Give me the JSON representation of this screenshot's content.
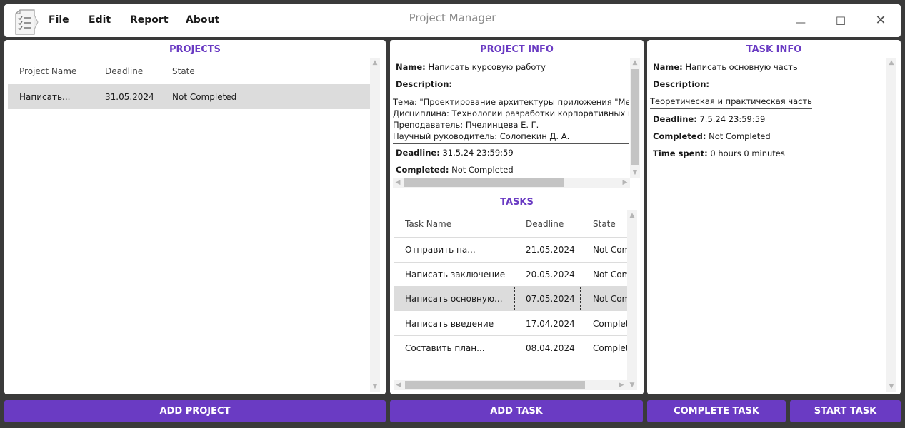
{
  "window": {
    "title": "Project Manager",
    "menu": [
      "File",
      "Edit",
      "Report",
      "About"
    ],
    "controls": {
      "minimize": "—",
      "maximize": "☐",
      "close": "✕"
    }
  },
  "projects": {
    "title": "PROJECTS",
    "columns": [
      "Project Name",
      "Deadline",
      "State"
    ],
    "rows": [
      {
        "name": "Написать...",
        "deadline": "31.05.2024",
        "state": "Not Completed",
        "selected": true
      }
    ]
  },
  "project_info": {
    "title": "PROJECT INFO",
    "name_label": "Name:",
    "name_value": "Написать курсовую работу",
    "description_label": "Description:",
    "description_lines": [
      "Тема: \"Проектирование архитектуры приложения \"Менедж",
      "Дисциплина: Технологии разработки корпоративных инфор",
      "Преподаватель: Пчелинцева Е. Г.",
      "Научный руководитель: Солопекин Д. А."
    ],
    "deadline_label": "Deadline:",
    "deadline_value": "31.5.24 23:59:59",
    "completed_label": "Completed:",
    "completed_value": "Not Completed"
  },
  "tasks": {
    "title": "TASKS",
    "columns": [
      "Task Name",
      "Deadline",
      "State"
    ],
    "rows": [
      {
        "name": "Отправить на...",
        "deadline": "21.05.2024",
        "state": "Not Com"
      },
      {
        "name": "Написать заключение",
        "deadline": "20.05.2024",
        "state": "Not Com"
      },
      {
        "name": "Написать основную...",
        "deadline": "07.05.2024",
        "state": "Not Com",
        "selected": true
      },
      {
        "name": "Написать введение",
        "deadline": "17.04.2024",
        "state": "Complet"
      },
      {
        "name": "Составить план...",
        "deadline": "08.04.2024",
        "state": "Complet"
      }
    ]
  },
  "task_info": {
    "title": "TASK INFO",
    "name_label": "Name:",
    "name_value": "Написать основную часть",
    "description_label": "Description:",
    "description_value": "Теоретическая и практическая часть",
    "deadline_label": "Deadline:",
    "deadline_value": "7.5.24 23:59:59",
    "completed_label": "Completed:",
    "completed_value": "Not Completed",
    "time_spent_label": "Time spent:",
    "time_spent_value": "0 hours 0 minutes"
  },
  "buttons": {
    "add_project": "ADD PROJECT",
    "add_task": "ADD TASK",
    "complete_task": "COMPLETE TASK",
    "start_task": "START TASK"
  },
  "colors": {
    "accent": "#6a3bc3",
    "selected_row": "#dcdcdc",
    "background": "#3a3a3a"
  },
  "icons": [
    "checklist-app-icon",
    "minimize-icon",
    "maximize-icon",
    "close-icon",
    "scroll-arrow-icon"
  ]
}
